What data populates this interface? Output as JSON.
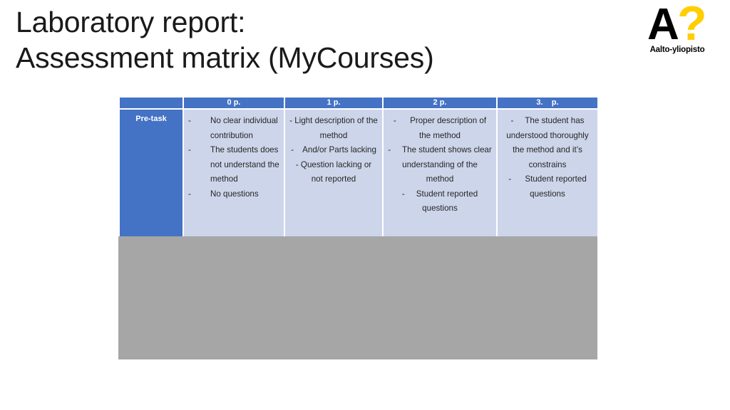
{
  "slide": {
    "title_line1": "Laboratory report:",
    "title_line2": "Assessment matrix (MyCourses)"
  },
  "logo": {
    "letter": "A",
    "question_mark": "?",
    "wordmark": "Aalto-yliopisto",
    "letter_color": "#000000",
    "question_color": "#FFCE00"
  },
  "colors": {
    "header_blue": "#4472C4",
    "cell_lavender": "#CDD5EA",
    "gray_block": "#A6A6A6",
    "text_dark": "#262626",
    "header_text": "#FFFFFF"
  },
  "matrix": {
    "corner_label": "",
    "columns": [
      {
        "label": "0 p."
      },
      {
        "label": "1 p."
      },
      {
        "label": "2 p."
      },
      {
        "label": "3.    p."
      }
    ],
    "rows": [
      {
        "label": "Pre-task",
        "cells": [
          {
            "align": "left",
            "items": [
              {
                "dash": "-",
                "text": "No clear individual contribution"
              },
              {
                "dash": "-",
                "text": "The students does not understand the method"
              },
              {
                "dash": "-",
                "text": "No questions"
              }
            ]
          },
          {
            "align": "center",
            "items": [
              {
                "dash": "- ",
                "text": "Light description of the method"
              },
              {
                "dash": "-    ",
                "text": "And/or Parts lacking"
              },
              {
                "dash": "- ",
                "text": "Question lacking or not reported"
              }
            ]
          },
          {
            "align": "center",
            "items": [
              {
                "dash": "-      ",
                "text": "Proper description of the method"
              },
              {
                "dash": "-     ",
                "text": "The student shows clear understanding of the method"
              },
              {
                "dash": "-     ",
                "text": "Student reported questions"
              }
            ]
          },
          {
            "align": "center",
            "items": [
              {
                "dash": "-     ",
                "text": "The student has understood thoroughly the method and it’s constrains"
              },
              {
                "dash": "-      ",
                "text": "Student reported questions"
              }
            ]
          }
        ]
      }
    ]
  }
}
